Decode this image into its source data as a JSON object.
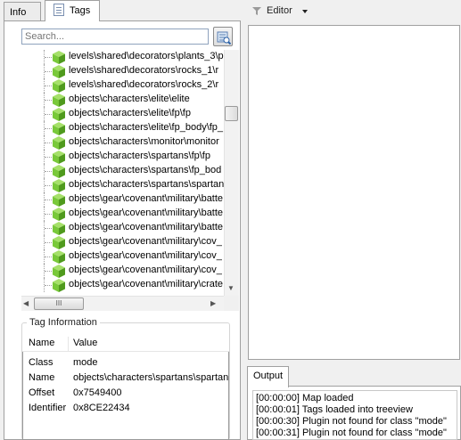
{
  "tabs": {
    "info": "Info",
    "tags": "Tags"
  },
  "search": {
    "placeholder": "Search..."
  },
  "tree": {
    "items": [
      "levels\\shared\\decorators\\plants_3\\p",
      "levels\\shared\\decorators\\rocks_1\\r",
      "levels\\shared\\decorators\\rocks_2\\r",
      "objects\\characters\\elite\\elite",
      "objects\\characters\\elite\\fp\\fp",
      "objects\\characters\\elite\\fp_body\\fp_",
      "objects\\characters\\monitor\\monitor",
      "objects\\characters\\spartans\\fp\\fp",
      "objects\\characters\\spartans\\fp_bod",
      "objects\\characters\\spartans\\spartan",
      "objects\\gear\\covenant\\military\\batte",
      "objects\\gear\\covenant\\military\\batte",
      "objects\\gear\\covenant\\military\\batte",
      "objects\\gear\\covenant\\military\\cov_",
      "objects\\gear\\covenant\\military\\cov_",
      "objects\\gear\\covenant\\military\\cov_",
      "objects\\gear\\covenant\\military\\crate"
    ]
  },
  "scroll": {
    "hthumb_grip": "III"
  },
  "tag_info": {
    "title": "Tag Information",
    "col_name": "Name",
    "col_value": "Value",
    "rows": [
      {
        "k": "Class",
        "v": "mode"
      },
      {
        "k": "Name",
        "v": "objects\\characters\\spartans\\spartan"
      },
      {
        "k": "Offset",
        "v": "0x7549400"
      },
      {
        "k": "Identifier",
        "v": "0x8CE22434"
      }
    ]
  },
  "editor": {
    "label": "Editor"
  },
  "output": {
    "tab": "Output",
    "lines": [
      "[00:00:00] Map loaded",
      "[00:00:01] Tags loaded into treeview",
      "[00:00:30] Plugin not found for class \"mode\"",
      "[00:00:31] Plugin not found for class \"mode\""
    ]
  },
  "colors": {
    "cube": "#79c93a",
    "cube_dark": "#4f9a1d",
    "border": "#a0a0a0"
  }
}
